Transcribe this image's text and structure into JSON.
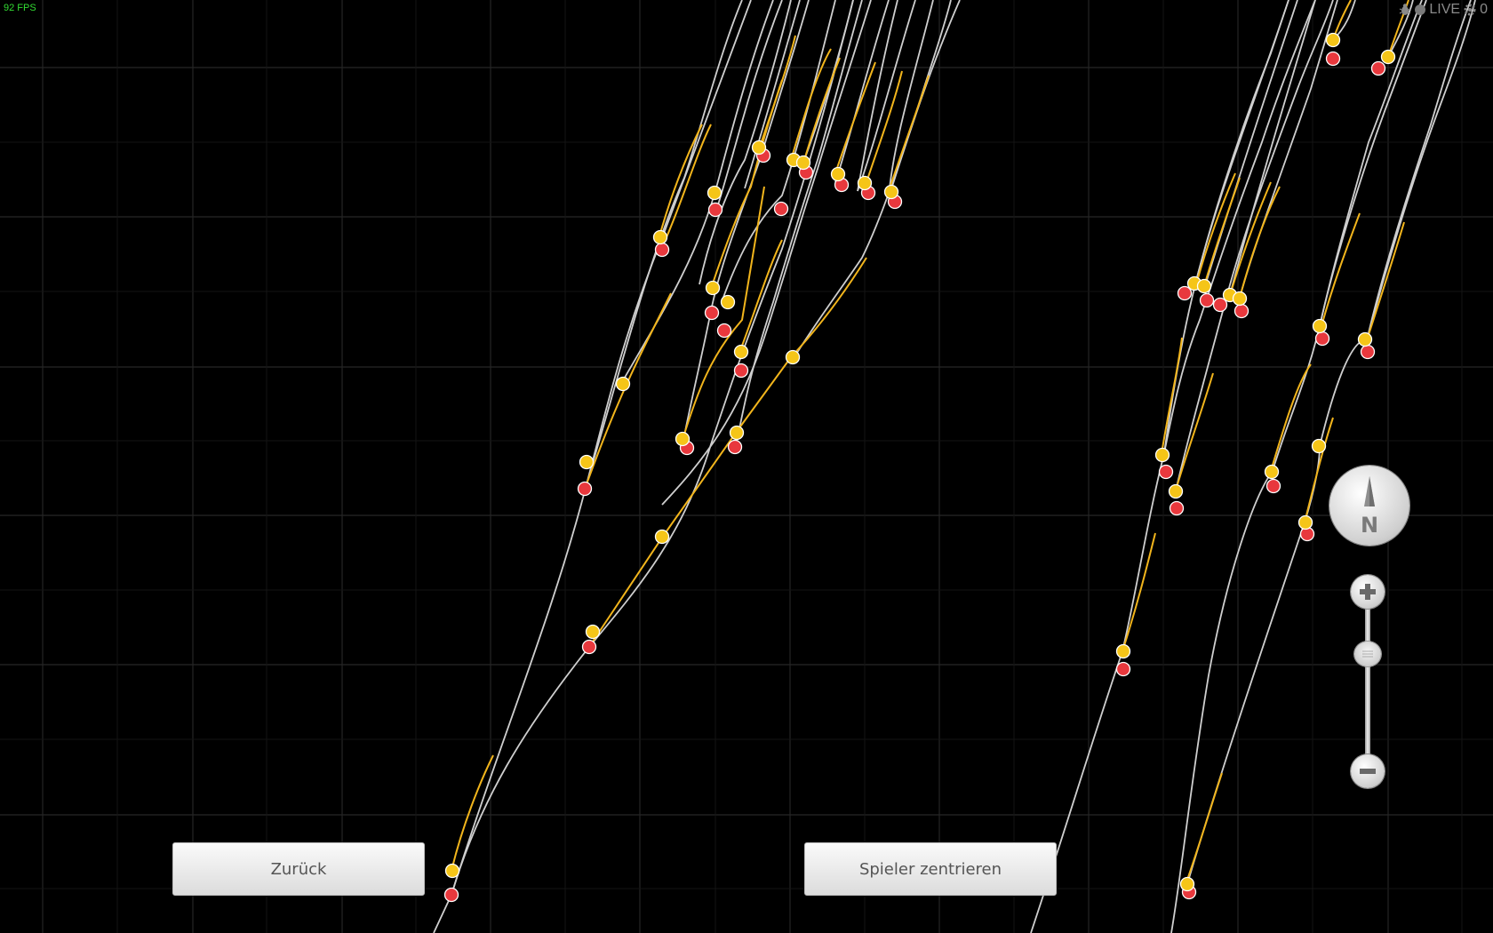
{
  "hud": {
    "fps_label": "92 FPS",
    "live_label": "LIVE",
    "counter_label": "0",
    "icons": [
      "bug-icon",
      "live-dot-icon",
      "settings-icon"
    ]
  },
  "buttons": {
    "back_label": "Zurück",
    "center_player_label": "Spieler zentrieren"
  },
  "compass": {
    "letter": "N"
  },
  "zoom": {
    "level_fraction": 0.22
  },
  "colors": {
    "background": "#000000",
    "grid": "#2a2a2a",
    "track_gray": "#cfcfcf",
    "track_yellow": "#f2b51c",
    "marker_yellow": "#f5c518",
    "marker_red": "#e8383d",
    "fps_green": "#33dd33"
  }
}
